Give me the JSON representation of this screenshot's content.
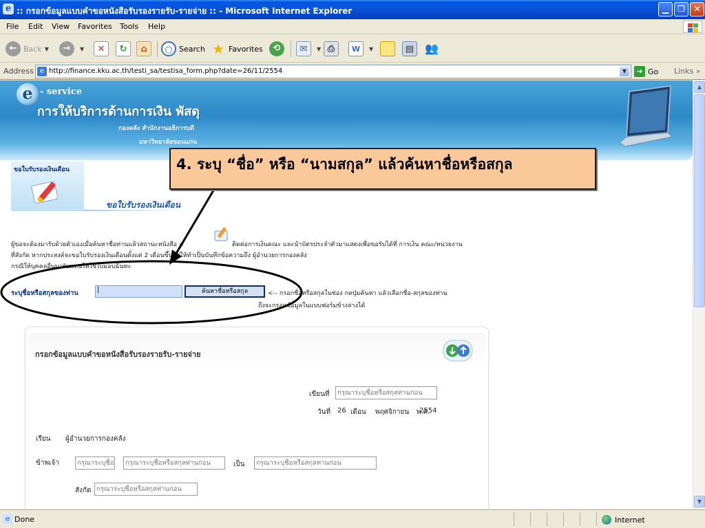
{
  "window": {
    "title": ":: กรอกข้อมูลแบบคำขอหนังสือรับรองรายรับ-รายจ่าย :: - Microsoft Internet Explorer",
    "minimize_glyph": "▁",
    "maximize_glyph": "❐",
    "close_glyph": "✕"
  },
  "menu": {
    "items": [
      "File",
      "Edit",
      "View",
      "Favorites",
      "Tools",
      "Help"
    ]
  },
  "toolbar": {
    "back_label": "Back",
    "search_label": "Search",
    "favorites_label": "Favorites",
    "icons": [
      "back-icon",
      "forward-icon",
      "stop-icon",
      "refresh-icon",
      "home-icon",
      "search-icon",
      "favorites-icon",
      "history-icon",
      "mail-icon",
      "print-icon",
      "edit-icon",
      "folder-icon",
      "research-icon",
      "messenger-icon"
    ]
  },
  "address": {
    "label": "Address",
    "url": "http://finance.kku.ac.th/testi_sa/testisa_form.php?date=26/11/2554",
    "go_label": "Go",
    "links_label": "Links"
  },
  "banner": {
    "logo_letter": "e",
    "service": "- service",
    "heading": "การให้บริการด้านการเงิน พัสดุ",
    "subline1": "กองคลัง สำนักงานอธิการบดี",
    "subline2": "มหาวิทยาลัยขอนแก่น"
  },
  "section": {
    "icon_label": "ขอใบรับรองเงินเดือน",
    "title": "ขอใบรับรองเงินเดือน"
  },
  "intro": {
    "line1": "ผู้ขอจะต้องมารับด้วยตัวเองเมื่อค้นหาชื่อท่านแล้วสถานะหนังสือ =",
    "line1b": "ติดต่อการเงินคณะ และนำบัตรประจำตัวมาแสดงเพื่อขอรับได้ที่ การเงิน คณะ/หน่วยงาน",
    "line2": "ที่สังกัด หากประสงค์จะขอใบรับรองเงินเดือนตั้งแต่ 2 เดือนขึ้นไปให้ทำเป็นบันทึกข้อความถึง ผู้อำนวยการกองคลัง",
    "line3": "กรณีให้บุคคลอื่นมารับแทนให้ใช้ใบมอบฉันทะ"
  },
  "search": {
    "label": "ระบุชื่อหรือสกุลของท่าน",
    "input_value": "|",
    "button_label": "ค้นหาชื่อหรือสกุล",
    "hint1": "<-- กรอกชื่อหรือสกุลในช่อง กดปุ่มค้นหา แล้วเลือกชื่อ-สกุลของท่าน",
    "hint2": "ถึงจะกรอกข้อมูลในแบบฟอร์มข้างล่างได้"
  },
  "form": {
    "title": "กรอกข้อมูลแบบคำขอหนังสือรับรองรายรับ-รายจ่าย",
    "written_at_label": "เขียนที่",
    "written_at_placeholder": "กรุณาระบุชื่อหรือสกุลท่านก่อน",
    "date_label": "วันที่",
    "date_day": "26",
    "date_month_label": "เดือน",
    "date_month": "พฤศจิกายน",
    "date_year_label": "พ.ศ.",
    "date_year": "2554",
    "dear_label": "เรียน",
    "dear_value": "ผู้อำนวยการกองคลัง",
    "i_label": "ข้าพเจ้า",
    "prefix_placeholder": "กรุณาระบุชื่อ",
    "name_placeholder": "กรุณาระบุชื่อหรือสกุลท่านก่อน",
    "position_label": "เป็น",
    "position_placeholder": "กรุณาระบุชื่อหรือสกุลท่านก่อน",
    "affiliation_label": "สังกัด",
    "affiliation_placeholder": "กรุณาระบุชื่อหรือสกุลท่านก่อน"
  },
  "annotation": {
    "text": "4. ระบุ “ชื่อ” หรือ “นามสกุล” แล้วค้นหาชื่อหรือสกุล",
    "color": "#fbc89a"
  },
  "status": {
    "text": "Done",
    "zone": "Internet"
  }
}
